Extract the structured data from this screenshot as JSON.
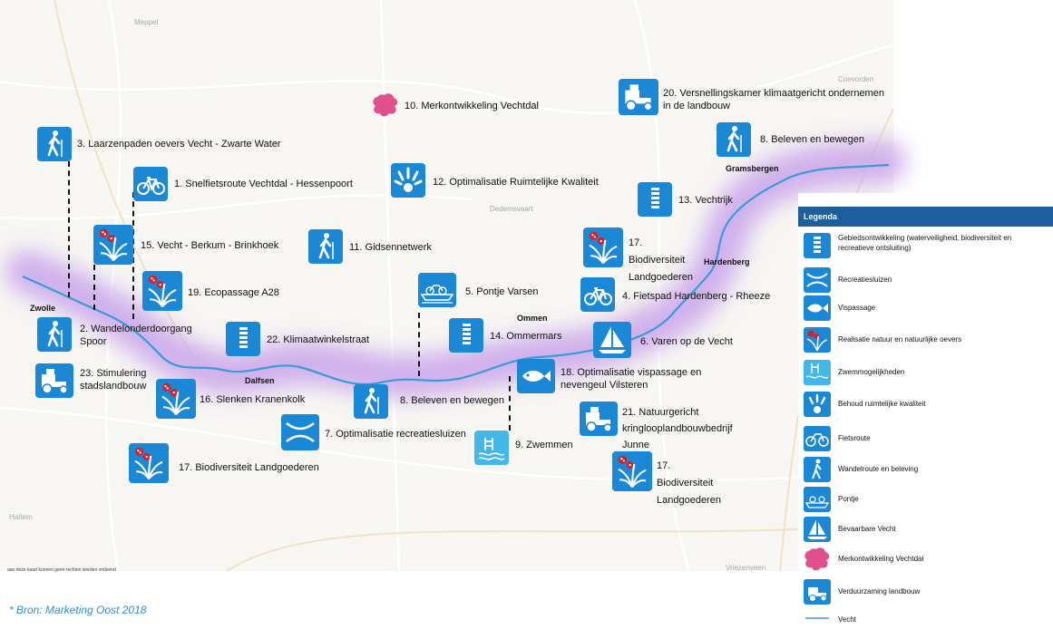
{
  "map_background": {
    "places": {
      "zwolle": "Zwolle",
      "dalfsen": "Dalfsen",
      "ommen": "Ommen",
      "hardenberg": "Hardenberg",
      "gramsbergen": "Gramsbergen"
    },
    "faint_places": {
      "meppel": "Meppel",
      "coevorden": "Coevorden",
      "dedemsvaart": "Dedemsvaart",
      "hattem": "Hattem",
      "vriezenveen": "Vriezenveen"
    },
    "disclaimer": "aan deze kaart kunnen geen rechten worden ontleend"
  },
  "map_labels": {
    "p3": "3. Laarzenpaden oevers Vecht - Zwarte Water",
    "p1": "1. Snelfietsroute Vechtdal - Hessenpoort",
    "p15": "15. Vecht - Berkum - Brinkhoek",
    "p11": "11. Gidsennetwerk",
    "p19": "19. Ecopassage A28",
    "p2": "2. Wandelonderdoorgang Spoor",
    "p22": "22. Klimaatwinkelstraat",
    "p23": "23. Stimulering stadslandbouw",
    "p16": "16. Slenken Kranenkolk",
    "p17a": "17. Biodiversiteit Landgoederen",
    "p10": "10. Merkontwikkeling Vechtdal",
    "p12": "12. Optimalisatie Ruimtelijke Kwaliteit",
    "p5": "5. Pontje Varsen",
    "p14": "14. Ommermars",
    "p8a": "8. Beleven en bewegen",
    "p7": "7. Optimalisatie recreatiesluizen",
    "p9": "9. Zwemmen",
    "p18": "18. Optimalisatie vispassage en nevengeul Vilsteren",
    "p20": "20. Versnellingskamer klimaatgericht ondernemen in de landbouw",
    "p8b": "8. Beleven en bewegen",
    "p13": "13. Vechtrijk",
    "p17b": "17. Biodiversiteit Landgoederen",
    "p4": "4. Fietspad Hardenberg - Rheeze",
    "p6": "6. Varen op de Vecht",
    "p21": "21. Natuurgericht kringlooplandbouwbedrijf Junne",
    "p17c": "17. Biodiversiteit Landgoederen"
  },
  "legend": {
    "title": "Legenda",
    "items": [
      {
        "icon": "ladder-icon",
        "text": "Gebiedsontwikkeling (waterveiligheid, biodiversiteit en recreatieve ontsluiting)"
      },
      {
        "icon": "lock-icon",
        "text": "Recreatiesluizen"
      },
      {
        "icon": "fish-icon",
        "text": "Vispassage"
      },
      {
        "icon": "flowers-icon",
        "text": "Realisatie natuur en natuurlijke oevers"
      },
      {
        "icon": "swimming-icon",
        "text": "Zwemmogelijkheden"
      },
      {
        "icon": "spark-icon",
        "text": "Behoud ruimtelijke kwaliteit"
      },
      {
        "icon": "bicycle-icon",
        "text": "Fietsroute"
      },
      {
        "icon": "hiker-icon",
        "text": "Wandelroute en beleving"
      },
      {
        "icon": "ferry-icon",
        "text": "Pontje"
      },
      {
        "icon": "sailboat-icon",
        "text": "Bevaarbare Vecht"
      },
      {
        "icon": "brand-blob-icon",
        "text": "Merkontwikkeling Vechtdal"
      },
      {
        "icon": "tractor-icon",
        "text": "Verduurzaming landbouw"
      },
      {
        "icon": "river-line-icon",
        "text": "Vecht"
      }
    ]
  },
  "source": "* Bron: Marketing Oost 2018",
  "colors": {
    "icon_blue": "#1a88d4",
    "icon_light": "#42b7e8",
    "river": "#3a9bd8",
    "haze": "#c9a4ea",
    "brand_pink": "#e0508c",
    "legend_head": "#1f5e9c",
    "source_text": "#2b8fd8"
  }
}
